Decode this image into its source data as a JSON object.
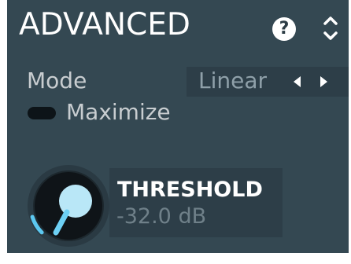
{
  "section": {
    "title": "ADVANCED",
    "help_label": "?",
    "help_icon": "question-icon",
    "collapse_icon": "chevrons-up-down-icon"
  },
  "mode": {
    "label": "Mode",
    "value": "Linear",
    "prev_icon": "arrow-left-icon",
    "next_icon": "arrow-right-icon"
  },
  "maximize": {
    "label": "Maximize",
    "enabled": false
  },
  "threshold": {
    "label": "THRESHOLD",
    "value": "-32.0 dB",
    "knob_level": 0.38
  },
  "colors": {
    "panel_bg": "#344852",
    "accent": "#5cc8f0",
    "value_text": "#6f8089"
  }
}
